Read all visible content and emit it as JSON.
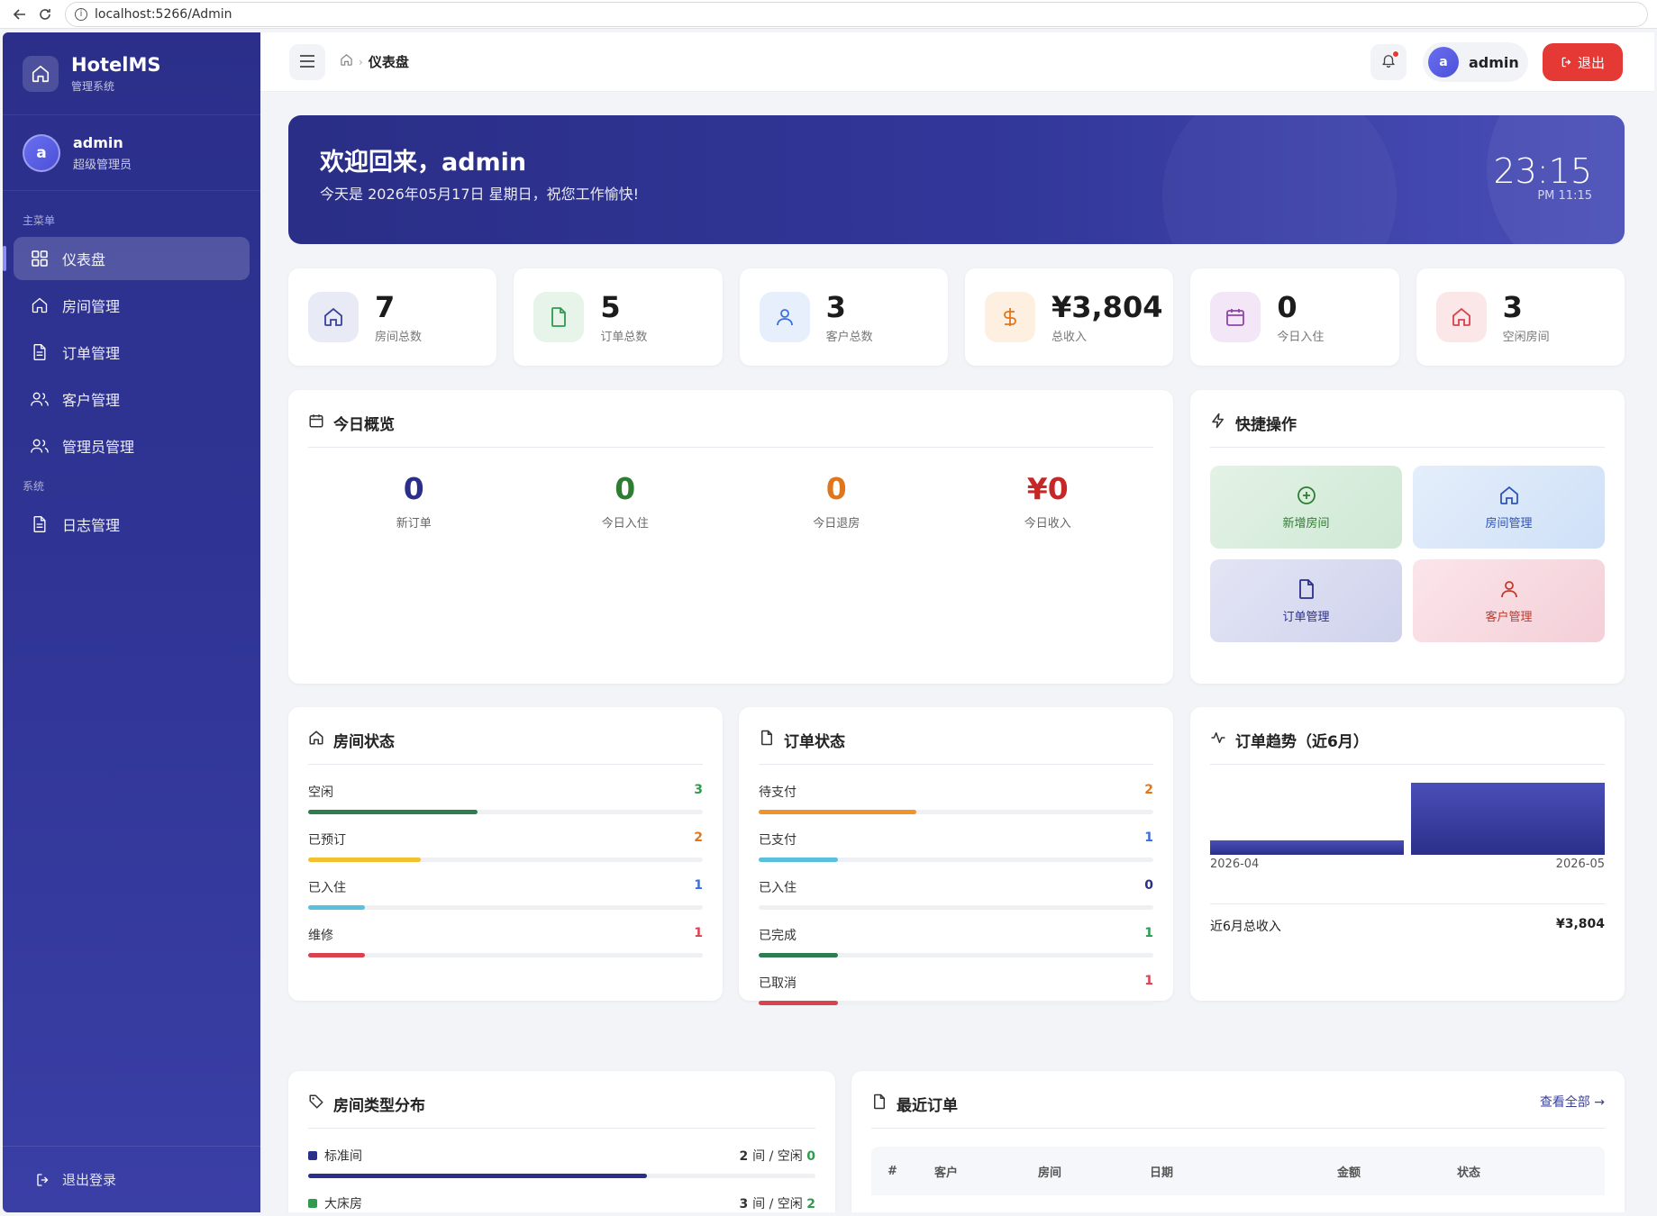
{
  "browser": {
    "url": "localhost:5266/Admin"
  },
  "sidebar": {
    "brand_name": "HotelMS",
    "brand_sub": "管理系统",
    "user_avatar": "a",
    "user_name": "admin",
    "user_role": "超级管理员",
    "section_main": "主菜单",
    "section_system": "系统",
    "items": [
      {
        "label": "仪表盘",
        "icon": "grid-icon"
      },
      {
        "label": "房间管理",
        "icon": "home-icon"
      },
      {
        "label": "订单管理",
        "icon": "document-icon"
      },
      {
        "label": "客户管理",
        "icon": "users-icon"
      },
      {
        "label": "管理员管理",
        "icon": "users-icon"
      },
      {
        "label": "日志管理",
        "icon": "document-icon"
      }
    ],
    "logout": "退出登录"
  },
  "topbar": {
    "breadcrumb_current": "仪表盘",
    "user_avatar": "a",
    "user_name": "admin",
    "logout": "退出"
  },
  "welcome": {
    "title": "欢迎回来，admin",
    "subtitle": "今天是 2026年05月17日 星期日，祝您工作愉快!",
    "time": "23:15",
    "time_sub": "PM 11:15"
  },
  "stats": [
    {
      "value": "7",
      "label": "房间总数",
      "icon": "home-icon",
      "color": "#3b4199",
      "bg": "#e8eaf6"
    },
    {
      "value": "5",
      "label": "订单总数",
      "icon": "document-icon",
      "color": "#2e9b4f",
      "bg": "#e6f4ea"
    },
    {
      "value": "3",
      "label": "客户总数",
      "icon": "user-icon",
      "color": "#3b6fd8",
      "bg": "#e6effb"
    },
    {
      "value": "¥3,804",
      "label": "总收入",
      "icon": "dollar-icon",
      "color": "#e0761c",
      "bg": "#fdf0e1"
    },
    {
      "value": "0",
      "label": "今日入住",
      "icon": "calendar-icon",
      "color": "#8e44ad",
      "bg": "#f3e7f7"
    },
    {
      "value": "3",
      "label": "空闲房间",
      "icon": "home-icon",
      "color": "#d9434f",
      "bg": "#fbe6e8"
    }
  ],
  "today": {
    "title": "今日概览",
    "items": [
      {
        "value": "0",
        "label": "新订单",
        "color": "#2b2f8a"
      },
      {
        "value": "0",
        "label": "今日入住",
        "color": "#2e7d32"
      },
      {
        "value": "0",
        "label": "今日退房",
        "color": "#e0761c"
      },
      {
        "value": "¥0",
        "label": "今日收入",
        "color": "#c62828"
      }
    ]
  },
  "quick": {
    "title": "快捷操作",
    "items": [
      {
        "label": "新增房间",
        "icon": "plus-circle-icon",
        "color": "#2e7d32",
        "bg": "linear-gradient(135deg,#e3f2e6,#cfe8d4)"
      },
      {
        "label": "房间管理",
        "icon": "home-icon",
        "color": "#2f55b8",
        "bg": "linear-gradient(135deg,#e4eefb,#cfe0f7)"
      },
      {
        "label": "订单管理",
        "icon": "document-icon",
        "color": "#2b2f8a",
        "bg": "linear-gradient(135deg,#e3e5f5,#cfd2ec)"
      },
      {
        "label": "客户管理",
        "icon": "user-icon",
        "color": "#c0392b",
        "bg": "linear-gradient(135deg,#fbe5ea,#f4cfd8)"
      }
    ]
  },
  "room_status": {
    "title": "房间状态",
    "total": 7,
    "items": [
      {
        "label": "空闲",
        "value": "3",
        "count": 3,
        "color": "#2e7d4f",
        "numColor": "#2e9b4f"
      },
      {
        "label": "已预订",
        "value": "2",
        "count": 2,
        "color": "#f2c12e",
        "numColor": "#e0761c"
      },
      {
        "label": "已入住",
        "value": "1",
        "count": 1,
        "color": "#5bc0de",
        "numColor": "#3b6fd8"
      },
      {
        "label": "维修",
        "value": "1",
        "count": 1,
        "color": "#d9434f",
        "numColor": "#d9434f"
      }
    ]
  },
  "order_status": {
    "title": "订单状态",
    "total": 5,
    "items": [
      {
        "label": "待支付",
        "value": "2",
        "count": 2,
        "color": "#f0932b",
        "numColor": "#e0761c"
      },
      {
        "label": "已支付",
        "value": "1",
        "count": 1,
        "color": "#5bc0de",
        "numColor": "#3b6fd8"
      },
      {
        "label": "已入住",
        "value": "0",
        "count": 0,
        "color": "#3b4199",
        "numColor": "#2b2f8a"
      },
      {
        "label": "已完成",
        "value": "1",
        "count": 1,
        "color": "#2e7d4f",
        "numColor": "#2e9b4f"
      },
      {
        "label": "已取消",
        "value": "1",
        "count": 1,
        "color": "#d9434f",
        "numColor": "#d9434f"
      }
    ]
  },
  "trend": {
    "title": "订单趋势（近6月）",
    "footer_label": "近6月总收入",
    "footer_value": "¥3,804"
  },
  "chart_data": {
    "type": "bar",
    "categories": [
      "2026-04",
      "2026-05"
    ],
    "values": [
      1,
      5
    ],
    "title": "订单趋势（近6月）",
    "xlabel": "",
    "ylabel": "",
    "ylim": [
      0,
      5
    ],
    "color": "#3b3f9e",
    "grid": false
  },
  "room_types": {
    "title": "房间类型分布",
    "items": [
      {
        "label": "标准间",
        "count": "2",
        "unit": "间 / 空闲",
        "free": "0",
        "ratio": 0.667,
        "color": "#2b2f8a"
      },
      {
        "label": "大床房",
        "count": "3",
        "unit": "间 / 空闲",
        "free": "2",
        "ratio": 1.0,
        "color": "#2e9b4f"
      }
    ]
  },
  "recent_orders": {
    "title": "最近订单",
    "more": "查看全部 →",
    "columns": [
      "#",
      "客户",
      "房间",
      "日期",
      "金额",
      "状态"
    ]
  }
}
